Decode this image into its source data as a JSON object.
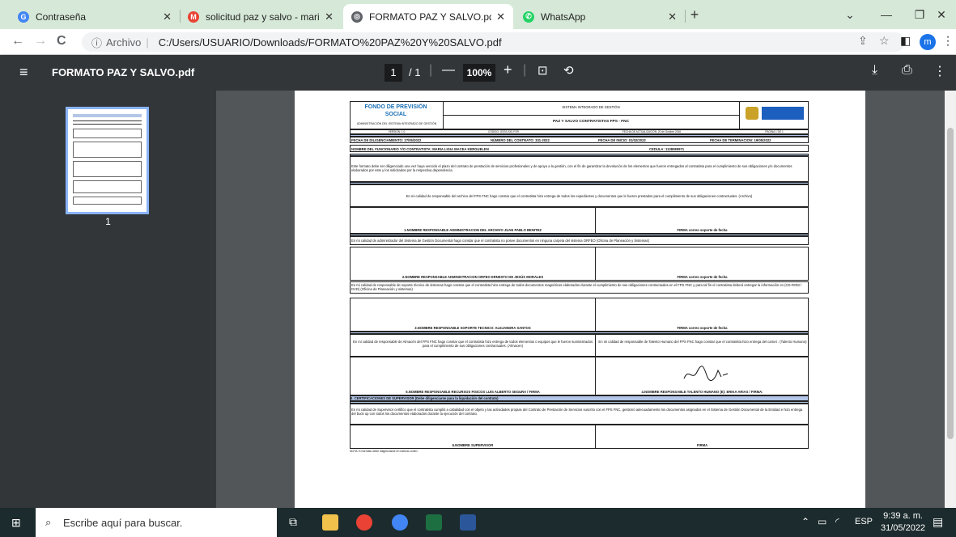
{
  "tabs": [
    {
      "title": "Contraseña",
      "icon": "google-icon"
    },
    {
      "title": "solicitud paz y salvo - marialigiar",
      "icon": "gmail-icon"
    },
    {
      "title": "FORMATO PAZ Y SALVO.pdf",
      "icon": "globe-icon"
    },
    {
      "title": "WhatsApp",
      "icon": "whatsapp-icon"
    }
  ],
  "address": {
    "prefix": "Archivo",
    "url": "C:/Users/USUARIO/Downloads/FORMATO%20PAZ%20Y%20SALVO.pdf"
  },
  "profile_initial": "m",
  "pdf": {
    "title": "FORMATO PAZ Y SALVO.pdf",
    "page": "1",
    "total": "/ 1",
    "zoom": "100%",
    "thumb_label": "1"
  },
  "document": {
    "header_org": "FONDO DE PREVISIÓN SOCIAL",
    "header_sub": "ADMINISTRACIÓN DEL SISTEMA INTEGRADO DE GESTIÓN",
    "system": "SISTEMA INTEGRADO DE GESTIÓN",
    "form_title": "PAZ Y SALVO CONTRATISTAS FPS - FNC",
    "version": "VERSIÓN: 1.0",
    "code": "CÓDIGO: GSSS-SIG-FOR",
    "update_date": "FECHA DE ACTUALIZACIÓN: 20 de Octubre 2016",
    "page_of": "PÁGINA 1 DE 1",
    "fill_date": "FECHA DE DILIGENCIAMIENTO: 27/05/2022",
    "contract_no": "NÚMERO DEL CONTRATO: 331-2022",
    "start_date": "FECHA DE INICIO: 01/02/2022",
    "end_date": "FECHA DE TERMINACION: 19/05/2022",
    "name": "NOMBRE DEL FUNCIONARIO Y/O CONTRATISTA: MARIA LIGIA MACEA KERGUELEN",
    "id": "CEDULA: 1138089971",
    "intro": "Este formato debe ser diligenciado una vez haya vencido el plazo del contrato de prestación de servicios profesionales y de apoyo a la gestión, con el fin de garantizar la devolución de los elementos que fueron entregados al contratista para el cumplimiento de sus obligaciones y/o documentos elaborados por este y los solicitados por la respectiva dependencia.",
    "archive_text": "En mi calidad de responsable del archivo del FPS FNC hago constar que el contratista hizo entrega de todos los expedientes y documentos que le fueron prestados para el cumplimiento de sus obligaciones contractuales. (Archivo)",
    "sig1": "1.NOMBRE RESPONSABLE ADMINISTRACION DEL ARCHIVO JUAN PABLO BENITEZ",
    "firma": "FIRMA correo soporte de fecha",
    "orfeo_text": "En mi calidad de administrador del Sistema de Gestión Documental hago constar que el contratista no posee documentos en ninguna carpeta del sistema ORFEO (Oficina de Planeación y Sistemas)",
    "sig2": "2.NOMBRE RESPONSABLE ADMINISTRACION ORFEO ERNESTO DE JESÚS MORALES",
    "tech_text": "En mi calidad de responsable de soporte técnico de sistemas hago constar que el contratista hizo entrega de todos documentos magnéticos elaborados durante el cumplimiento de sus obligaciones contractuales en el FPS FNC y para tal fin el contratista deberá entregar la información en (CD-ROM / DVD) (Oficina de Planeación y sistemas)",
    "sig3": "3.NOMBRE RESPONSABLE SOPORTE TECNICO: ALEJANDRA SANTOS",
    "almacen_text": "En mi calidad de responsable de Almacén del FPS FNC hago constar que el contratista hizo entrega de todos elementos o equipos que le fueron suministrados para el cumplimiento de sus obligaciones contractuales. (Almacen)",
    "th_text": "En mi calidad de responsable de Talento Humano del FPS FNC hago constar que el contratista hizo entrega del carnet . (Talento Humano)",
    "sig4": "5.NOMBRE RESPONSABLE RECURSOS FISICOS LUIS ALBERTO SEGURA / FIRMA",
    "sig5": "4.NOMBRE RESPONSABLE TALENTO HUMANO (E): ERIKA ARIAS / FIRMA:",
    "cert_header": "II. CERTIFICACIONES DE SUPERVISOR (Debe diligenciarse para la liquidación del contrato)",
    "cert_text": "En mi calidad de Supervisor certifico que el contratista cumplió a cabalidad con el objeto y las actividades propias del Contrato de Prestación de Servicios suscrito con el FPS FNC, gestionó adecuadamente los documentos asignados en el Sistema de Gestión Documental de la Entidad e hizo entrega del buck up con todos los documentos elaborados durante la ejecución del contrato.",
    "sig6": "6.NOMBRE SUPERVISOR",
    "firma2": "FIRMA",
    "note": "NOTA: El formato debe diligenciarse en estricto orden"
  },
  "taskbar": {
    "search_placeholder": "Escribe aquí para buscar.",
    "lang": "ESP",
    "time": "9:39 a. m.",
    "date": "31/05/2022"
  }
}
